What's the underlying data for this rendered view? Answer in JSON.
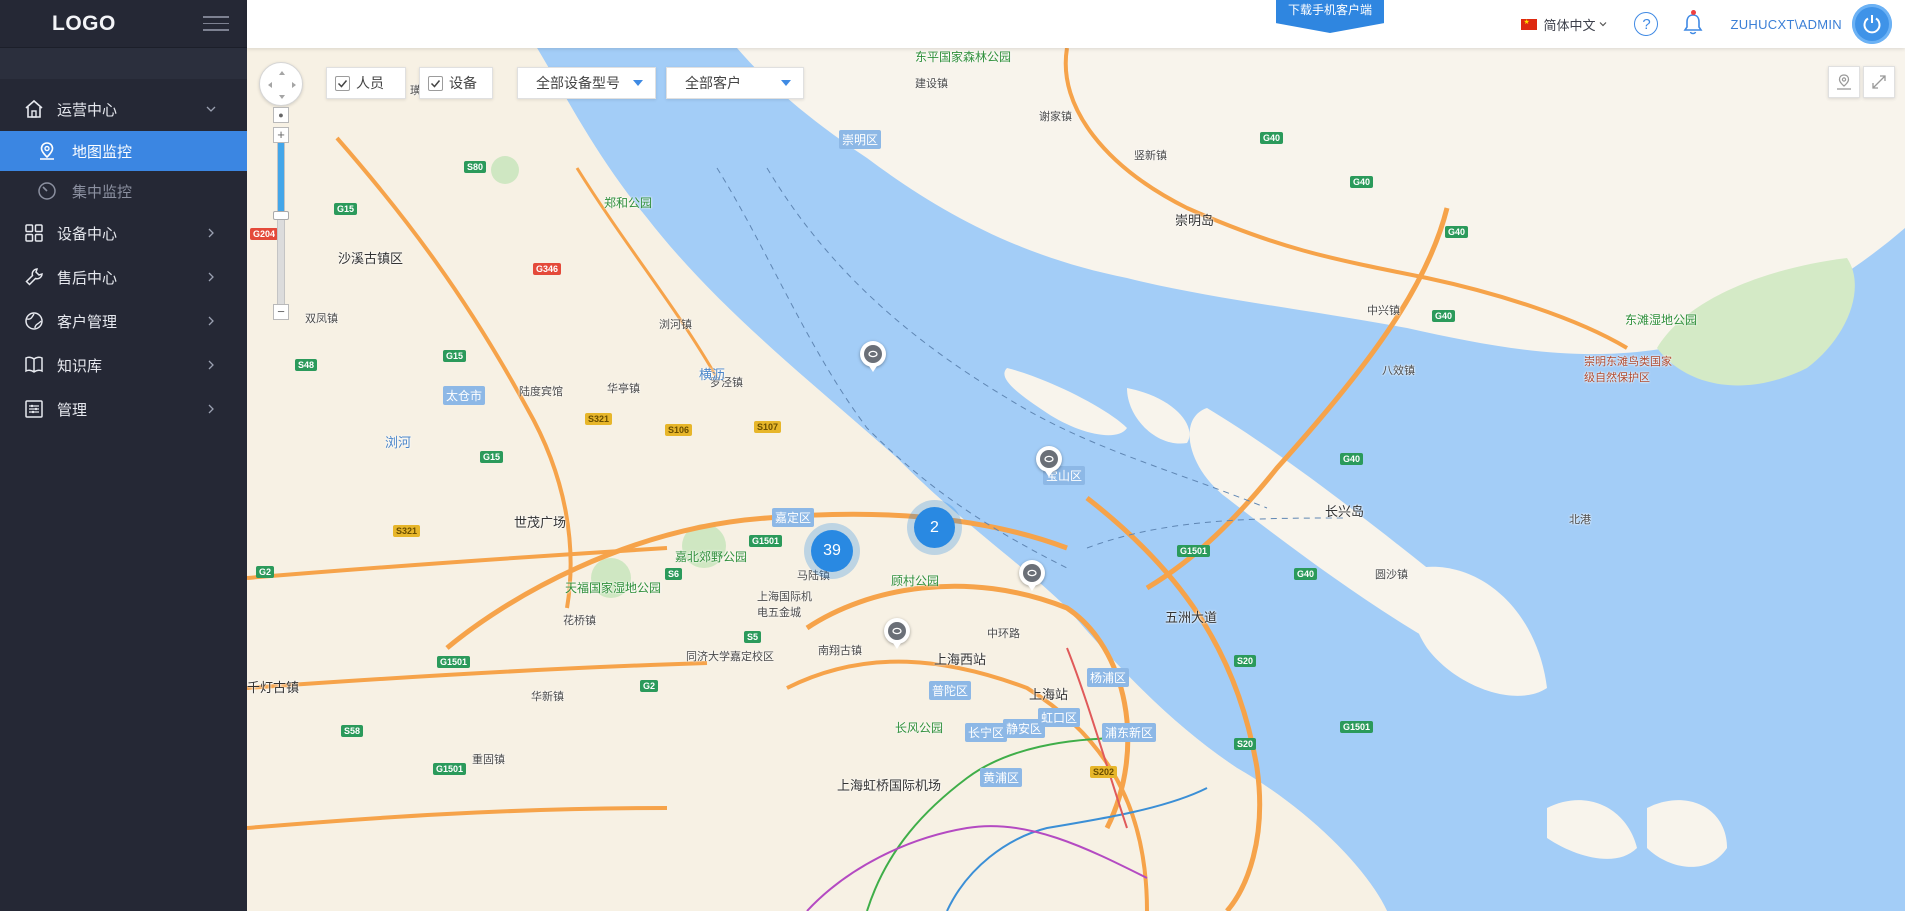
{
  "sidebar": {
    "logo": "LOGO",
    "menu": [
      {
        "label": "运营中心",
        "icon": "home-icon",
        "expanded": true,
        "children": [
          {
            "label": "地图监控",
            "icon": "map-pin-icon",
            "active": true
          },
          {
            "label": "集中监控",
            "icon": "gauge-icon",
            "active": false
          }
        ]
      },
      {
        "label": "设备中心",
        "icon": "grid-icon"
      },
      {
        "label": "售后中心",
        "icon": "wrench-icon"
      },
      {
        "label": "客户管理",
        "icon": "globe-icon"
      },
      {
        "label": "知识库",
        "icon": "book-icon"
      },
      {
        "label": "管理",
        "icon": "settings-list-icon"
      }
    ]
  },
  "header": {
    "download_label": "下载手机客户端",
    "language": "简体中文",
    "user": "ZUHUCXT\\ADMIN"
  },
  "filters": {
    "person_label": "人员",
    "person_checked": true,
    "device_label": "设备",
    "device_checked": true,
    "model_select": "全部设备型号",
    "customer_select": "全部客户"
  },
  "map": {
    "clusters": [
      {
        "count": "39"
      },
      {
        "count": "2"
      }
    ],
    "places": [
      "东平国家森林公园",
      "建设镇",
      "崇明区",
      "谢家镇",
      "竖新镇",
      "崇明岛",
      "郑和公园",
      "沙溪古镇区",
      "璜泾镇",
      "双凤镇",
      "浏河镇",
      "太仓市",
      "陆度宾馆",
      "华亭镇",
      "罗泾镇",
      "横沥",
      "浏河",
      "中兴镇",
      "八效镇",
      "东滩湿地公园",
      "崇明东滩鸟类国家级自然保护区",
      "宝山区",
      "长兴岛",
      "北港",
      "嘉定区",
      "顾村公园",
      "嘉北郊野公园",
      "世茂广场",
      "马陆镇",
      "上海国际机电五金城",
      "天福国家湿地公园",
      "花桥镇",
      "同济大学嘉定校区",
      "南翔古镇",
      "中环路",
      "五洲大道",
      "上海西站",
      "上海站",
      "杨浦区",
      "普陀区",
      "长风公园",
      "长宁区",
      "静安区",
      "虹口区",
      "黄浦区",
      "浦东新区",
      "千灯古镇",
      "华新镇",
      "重固镇",
      "上海虹桥国际机场",
      "圆沙镇"
    ],
    "roads": [
      "G40",
      "G1501",
      "G15",
      "S80",
      "G204",
      "G346",
      "S48",
      "S321",
      "S106",
      "S107",
      "G2",
      "S6",
      "S5",
      "S20",
      "S58",
      "S202"
    ]
  },
  "colors": {
    "accent": "#2f86e0",
    "sidebar_bg": "#252835",
    "water": "#a3cdf7",
    "land": "#f8f4ec"
  }
}
